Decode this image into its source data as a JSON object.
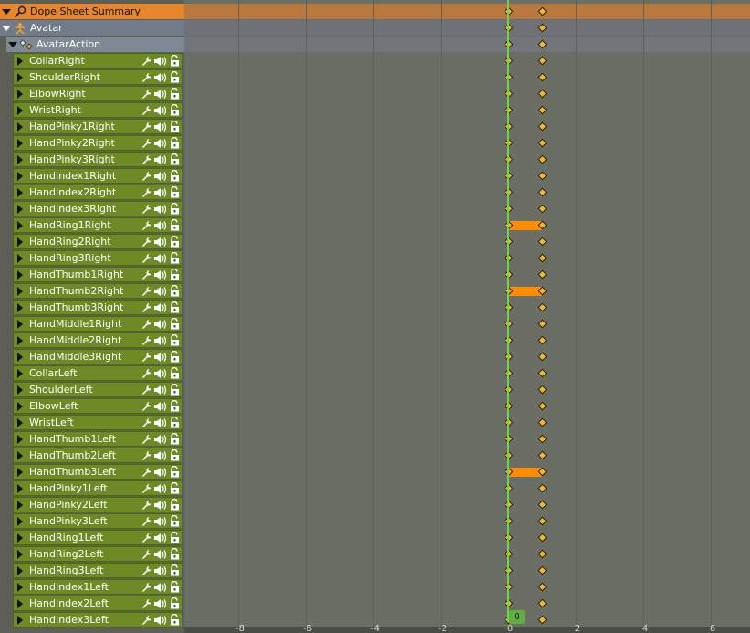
{
  "summary": {
    "label": "Dope Sheet Summary",
    "icon": "dopesheet-summary-icon"
  },
  "object": {
    "label": "Avatar",
    "icon": "armature-icon"
  },
  "action": {
    "label": "AvatarAction",
    "icon": "action-icon"
  },
  "channels": [
    "CollarRight",
    "ShoulderRight",
    "ElbowRight",
    "WristRight",
    "HandPinky1Right",
    "HandPinky2Right",
    "HandPinky3Right",
    "HandIndex1Right",
    "HandIndex2Right",
    "HandIndex3Right",
    "HandRing1Right",
    "HandRing2Right",
    "HandRing3Right",
    "HandThumb1Right",
    "HandThumb2Right",
    "HandThumb3Right",
    "HandMiddle1Right",
    "HandMiddle2Right",
    "HandMiddle3Right",
    "CollarLeft",
    "ShoulderLeft",
    "ElbowLeft",
    "WristLeft",
    "HandThumb1Left",
    "HandThumb2Left",
    "HandThumb3Left",
    "HandPinky1Left",
    "HandPinky2Left",
    "HandPinky3Left",
    "HandRing1Left",
    "HandRing2Left",
    "HandRing3Left",
    "HandIndex1Left",
    "HandIndex2Left",
    "HandIndex3Left"
  ],
  "channel_tools": [
    "modifier-wrench-icon",
    "speaker-mute-icon",
    "lock-icon"
  ],
  "keyframe_frames": [
    0,
    1
  ],
  "holds": [
    "HandRing1Right",
    "HandThumb2Right",
    "HandThumb3Left"
  ],
  "current_frame": "0",
  "ruler_ticks": [
    "-8",
    "-6",
    "-4",
    "-2",
    "0",
    "2",
    "4",
    "6"
  ],
  "colors": {
    "summary": "#e7862b",
    "channel": "#6e8a25",
    "keyframe": "#f4b62b",
    "hold": "#ff8c00",
    "playhead": "#74d14c"
  }
}
